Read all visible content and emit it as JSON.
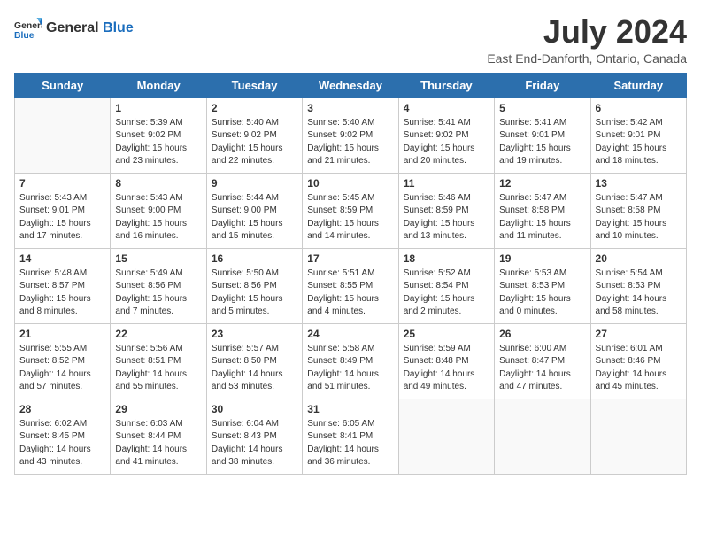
{
  "header": {
    "logo_general": "General",
    "logo_blue": "Blue",
    "month_title": "July 2024",
    "location": "East End-Danforth, Ontario, Canada"
  },
  "days_of_week": [
    "Sunday",
    "Monday",
    "Tuesday",
    "Wednesday",
    "Thursday",
    "Friday",
    "Saturday"
  ],
  "weeks": [
    [
      {
        "day": "",
        "info": ""
      },
      {
        "day": "1",
        "info": "Sunrise: 5:39 AM\nSunset: 9:02 PM\nDaylight: 15 hours\nand 23 minutes."
      },
      {
        "day": "2",
        "info": "Sunrise: 5:40 AM\nSunset: 9:02 PM\nDaylight: 15 hours\nand 22 minutes."
      },
      {
        "day": "3",
        "info": "Sunrise: 5:40 AM\nSunset: 9:02 PM\nDaylight: 15 hours\nand 21 minutes."
      },
      {
        "day": "4",
        "info": "Sunrise: 5:41 AM\nSunset: 9:02 PM\nDaylight: 15 hours\nand 20 minutes."
      },
      {
        "day": "5",
        "info": "Sunrise: 5:41 AM\nSunset: 9:01 PM\nDaylight: 15 hours\nand 19 minutes."
      },
      {
        "day": "6",
        "info": "Sunrise: 5:42 AM\nSunset: 9:01 PM\nDaylight: 15 hours\nand 18 minutes."
      }
    ],
    [
      {
        "day": "7",
        "info": "Sunrise: 5:43 AM\nSunset: 9:01 PM\nDaylight: 15 hours\nand 17 minutes."
      },
      {
        "day": "8",
        "info": "Sunrise: 5:43 AM\nSunset: 9:00 PM\nDaylight: 15 hours\nand 16 minutes."
      },
      {
        "day": "9",
        "info": "Sunrise: 5:44 AM\nSunset: 9:00 PM\nDaylight: 15 hours\nand 15 minutes."
      },
      {
        "day": "10",
        "info": "Sunrise: 5:45 AM\nSunset: 8:59 PM\nDaylight: 15 hours\nand 14 minutes."
      },
      {
        "day": "11",
        "info": "Sunrise: 5:46 AM\nSunset: 8:59 PM\nDaylight: 15 hours\nand 13 minutes."
      },
      {
        "day": "12",
        "info": "Sunrise: 5:47 AM\nSunset: 8:58 PM\nDaylight: 15 hours\nand 11 minutes."
      },
      {
        "day": "13",
        "info": "Sunrise: 5:47 AM\nSunset: 8:58 PM\nDaylight: 15 hours\nand 10 minutes."
      }
    ],
    [
      {
        "day": "14",
        "info": "Sunrise: 5:48 AM\nSunset: 8:57 PM\nDaylight: 15 hours\nand 8 minutes."
      },
      {
        "day": "15",
        "info": "Sunrise: 5:49 AM\nSunset: 8:56 PM\nDaylight: 15 hours\nand 7 minutes."
      },
      {
        "day": "16",
        "info": "Sunrise: 5:50 AM\nSunset: 8:56 PM\nDaylight: 15 hours\nand 5 minutes."
      },
      {
        "day": "17",
        "info": "Sunrise: 5:51 AM\nSunset: 8:55 PM\nDaylight: 15 hours\nand 4 minutes."
      },
      {
        "day": "18",
        "info": "Sunrise: 5:52 AM\nSunset: 8:54 PM\nDaylight: 15 hours\nand 2 minutes."
      },
      {
        "day": "19",
        "info": "Sunrise: 5:53 AM\nSunset: 8:53 PM\nDaylight: 15 hours\nand 0 minutes."
      },
      {
        "day": "20",
        "info": "Sunrise: 5:54 AM\nSunset: 8:53 PM\nDaylight: 14 hours\nand 58 minutes."
      }
    ],
    [
      {
        "day": "21",
        "info": "Sunrise: 5:55 AM\nSunset: 8:52 PM\nDaylight: 14 hours\nand 57 minutes."
      },
      {
        "day": "22",
        "info": "Sunrise: 5:56 AM\nSunset: 8:51 PM\nDaylight: 14 hours\nand 55 minutes."
      },
      {
        "day": "23",
        "info": "Sunrise: 5:57 AM\nSunset: 8:50 PM\nDaylight: 14 hours\nand 53 minutes."
      },
      {
        "day": "24",
        "info": "Sunrise: 5:58 AM\nSunset: 8:49 PM\nDaylight: 14 hours\nand 51 minutes."
      },
      {
        "day": "25",
        "info": "Sunrise: 5:59 AM\nSunset: 8:48 PM\nDaylight: 14 hours\nand 49 minutes."
      },
      {
        "day": "26",
        "info": "Sunrise: 6:00 AM\nSunset: 8:47 PM\nDaylight: 14 hours\nand 47 minutes."
      },
      {
        "day": "27",
        "info": "Sunrise: 6:01 AM\nSunset: 8:46 PM\nDaylight: 14 hours\nand 45 minutes."
      }
    ],
    [
      {
        "day": "28",
        "info": "Sunrise: 6:02 AM\nSunset: 8:45 PM\nDaylight: 14 hours\nand 43 minutes."
      },
      {
        "day": "29",
        "info": "Sunrise: 6:03 AM\nSunset: 8:44 PM\nDaylight: 14 hours\nand 41 minutes."
      },
      {
        "day": "30",
        "info": "Sunrise: 6:04 AM\nSunset: 8:43 PM\nDaylight: 14 hours\nand 38 minutes."
      },
      {
        "day": "31",
        "info": "Sunrise: 6:05 AM\nSunset: 8:41 PM\nDaylight: 14 hours\nand 36 minutes."
      },
      {
        "day": "",
        "info": ""
      },
      {
        "day": "",
        "info": ""
      },
      {
        "day": "",
        "info": ""
      }
    ]
  ]
}
